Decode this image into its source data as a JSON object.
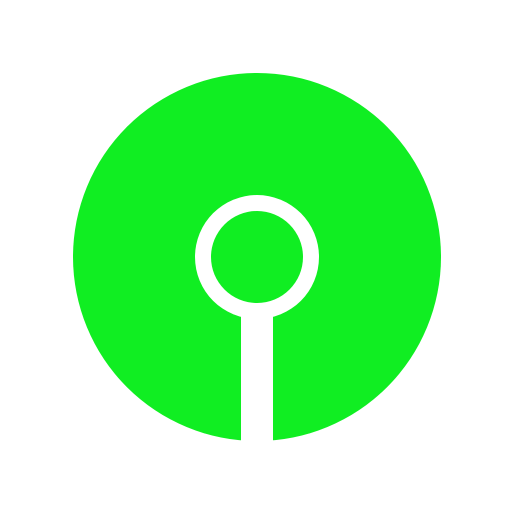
{
  "logo": {
    "name": "keyhole-circle-logo",
    "colors": {
      "primary": "#10EE22",
      "background": "#FFFFFF"
    }
  }
}
